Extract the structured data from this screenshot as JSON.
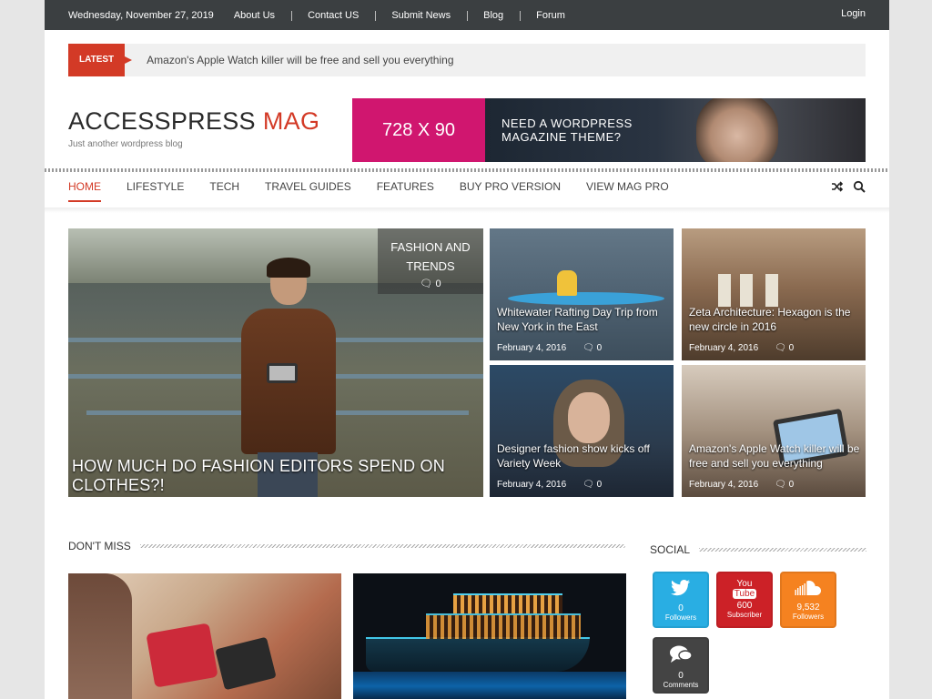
{
  "topbar": {
    "date": "Wednesday, November 27, 2019",
    "nav": [
      "About Us",
      "Contact US",
      "Submit News",
      "Blog",
      "Forum"
    ],
    "login": "Login"
  },
  "latest": {
    "label": "Latest",
    "headline": "Amazon's Apple Watch killer will be free and sell you everything"
  },
  "header": {
    "logo_part1": "ACCESSPRESS",
    "logo_part2": "MAG",
    "tagline": "Just another wordpress blog",
    "ad_size": "728 X 90",
    "ad_line1": "NEED A WORDPRESS",
    "ad_line2": "MAGAZINE THEME?"
  },
  "mainnav": {
    "items": [
      "Home",
      "Lifestyle",
      "Tech",
      "Travel Guides",
      "Features",
      "Buy Pro Version",
      "View Mag Pro"
    ],
    "active_index": 0,
    "icons": [
      "shuffle-icon",
      "search-icon"
    ]
  },
  "featured": {
    "big": {
      "category_line1": "FASHION AND",
      "category_line2": "TRENDS",
      "comments": "0",
      "title": "HOW MUCH DO FASHION EDITORS SPEND ON CLOTHES?!"
    },
    "small": [
      {
        "title": "Whitewater Rafting Day Trip from New York in the East",
        "date": "February 4, 2016",
        "comments": "0"
      },
      {
        "title": "Zeta Architecture: Hexagon is the new circle in 2016",
        "date": "February 4, 2016",
        "comments": "0"
      },
      {
        "title": "Designer fashion show kicks off Variety Week",
        "date": "February 4, 2016",
        "comments": "0"
      },
      {
        "title": "Amazon's Apple Watch killer will be free and sell you everything",
        "date": "February 4, 2016",
        "comments": "0"
      }
    ]
  },
  "dont_miss": {
    "heading": "DON'T MISS"
  },
  "social": {
    "heading": "SOCIAL",
    "twitter": {
      "count": "0",
      "label": "Followers"
    },
    "youtube": {
      "logo_you": "You",
      "logo_tube": "Tube",
      "count": "600",
      "label": "Subscriber"
    },
    "soundcloud": {
      "count": "9,532",
      "label": "Followers"
    },
    "comments": {
      "count": "0",
      "label": "Comments"
    }
  },
  "colors": {
    "accent": "#d33a26",
    "topbar": "#3b3f41",
    "ad_pink": "#d0166f",
    "twitter": "#29aee3",
    "youtube": "#cc2127",
    "soundcloud": "#f58220",
    "comments": "#444444"
  }
}
